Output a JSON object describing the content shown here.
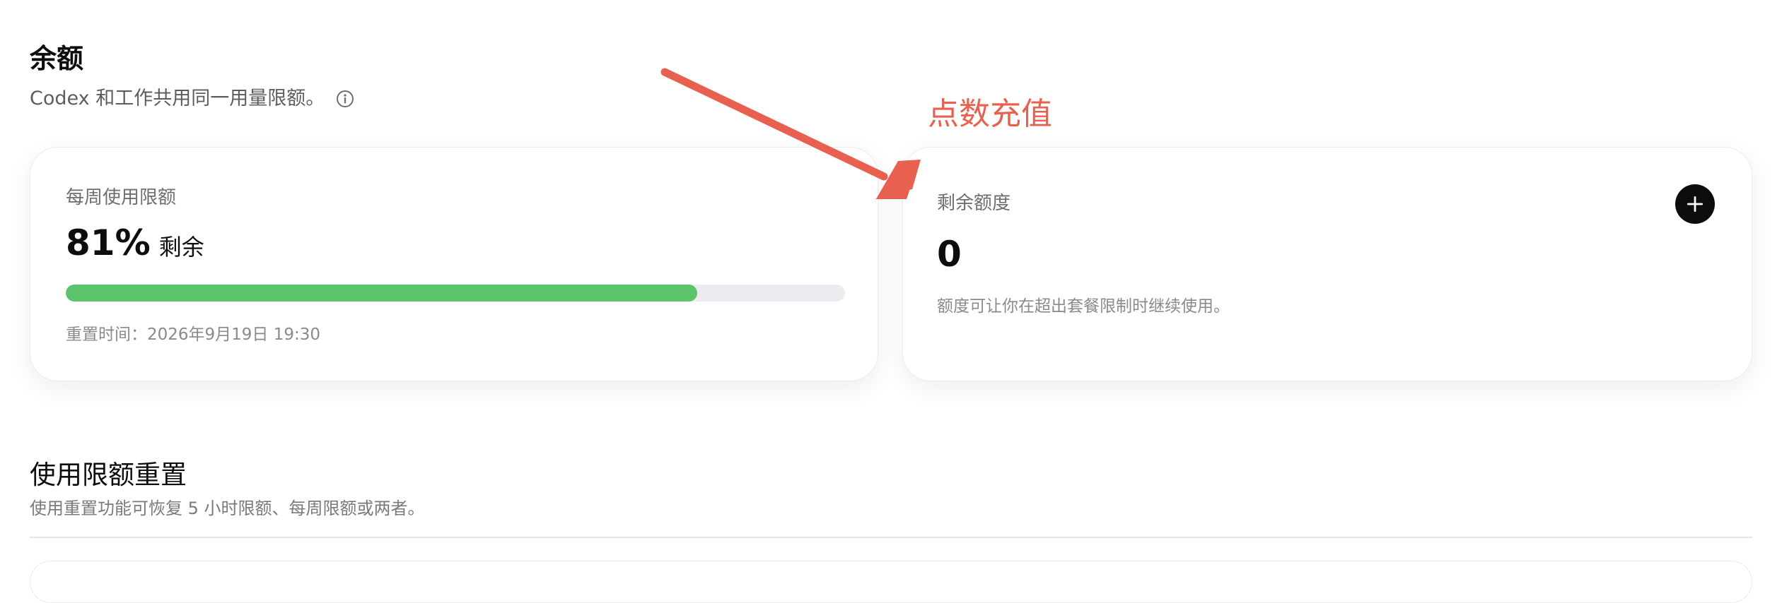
{
  "balance": {
    "title": "余额",
    "subtitle": "Codex 和工作共用同一用量限额。",
    "info_icon": "info-circle-icon"
  },
  "weekly_card": {
    "label": "每周使用限额",
    "percent_text": "81%",
    "percent_suffix": "剩余",
    "progress_fraction": 0.81,
    "progress_color": "#5cc46b",
    "reset_text": "重置时间：2026年9月19日 19:30"
  },
  "credit_card": {
    "label": "剩余额度",
    "value": "0",
    "description": "额度可让你在超出套餐限制时继续使用。",
    "add_icon": "plus-icon"
  },
  "annotation": {
    "text": "点数充值",
    "color": "#e8604f"
  },
  "usage_reset": {
    "title": "使用限额重置",
    "subtitle": "使用重置功能可恢复 5 小时限额、每周限额或两者。"
  }
}
